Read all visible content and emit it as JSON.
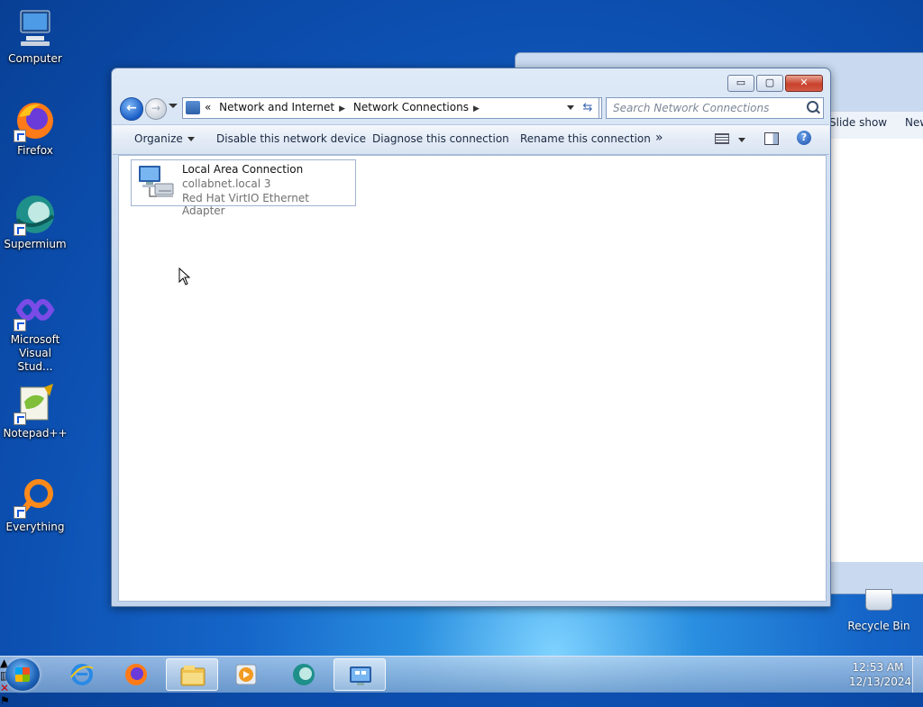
{
  "desktop": {
    "icons": [
      {
        "label": "Computer"
      },
      {
        "label": "Firefox"
      },
      {
        "label": "Supermium"
      },
      {
        "label": "Microsoft Visual Stud..."
      },
      {
        "label": "Notepad++"
      },
      {
        "label": "Everything"
      }
    ],
    "recycle_bin": "Recycle Bin"
  },
  "background_window": {
    "commands": [
      "Slide show",
      "New"
    ]
  },
  "window": {
    "caption_buttons": {
      "minimize": "▭",
      "maximize": "▢",
      "close": "✕"
    },
    "address": {
      "prefix": "«",
      "crumbs": [
        "Network and Internet",
        "Network Connections"
      ]
    },
    "search_placeholder": "Search Network Connections",
    "toolbar": {
      "organize": "Organize",
      "disable": "Disable this network device",
      "diagnose": "Diagnose this connection",
      "rename": "Rename this connection",
      "more": "»"
    },
    "connections": [
      {
        "name": "Local Area Connection",
        "network": "collabnet.local  3",
        "adapter": "Red Hat VirtIO Ethernet Adapter"
      }
    ]
  },
  "taskbar": {
    "apps": [
      "internet-explorer-icon",
      "firefox-icon",
      "file-explorer-icon",
      "media-player-icon",
      "supermium-icon",
      "network-connections-icon"
    ],
    "clock": {
      "time": "12:53 AM",
      "date": "12/13/2024"
    }
  },
  "colors": {
    "accent": "#1c5fb4",
    "selection_border": "#9fb3d1"
  }
}
